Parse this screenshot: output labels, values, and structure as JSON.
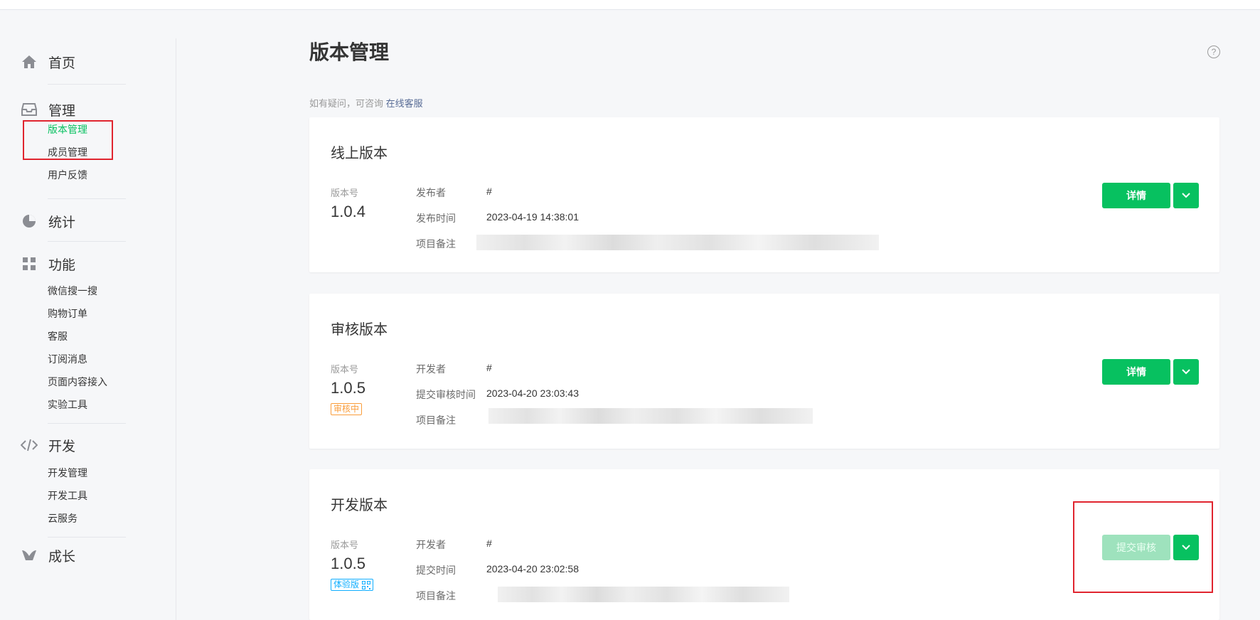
{
  "sidebar": {
    "home": "首页",
    "manage": "管理",
    "manage_items": [
      "版本管理",
      "成员管理",
      "用户反馈"
    ],
    "stats": "统计",
    "features": "功能",
    "feature_items": [
      "微信搜一搜",
      "购物订单",
      "客服",
      "订阅消息",
      "页面内容接入",
      "实验工具"
    ],
    "develop": "开发",
    "develop_items": [
      "开发管理",
      "开发工具",
      "云服务"
    ],
    "growth": "成长",
    "active_item": "版本管理"
  },
  "main": {
    "title": "版本管理",
    "help_icon": "?",
    "hint_text": "如有疑问，可咨询",
    "hint_link": "在线客服",
    "cards": [
      {
        "title": "线上版本",
        "version_label": "版本号",
        "version": "1.0.4",
        "badge": "",
        "rows": [
          {
            "label": "发布者",
            "value": "#"
          },
          {
            "label": "发布时间",
            "value": "2023-04-19 14:38:01"
          },
          {
            "label": "项目备注",
            "value": ""
          }
        ],
        "button": "详情"
      },
      {
        "title": "审核版本",
        "version_label": "版本号",
        "version": "1.0.5",
        "badge": "审核中",
        "rows": [
          {
            "label": "开发者",
            "value": "#"
          },
          {
            "label": "提交审核时间",
            "value": "2023-04-20 23:03:43"
          },
          {
            "label": "项目备注",
            "value": ""
          }
        ],
        "button": "详情"
      },
      {
        "title": "开发版本",
        "version_label": "版本号",
        "version": "1.0.5",
        "badge": "体验版",
        "rows": [
          {
            "label": "开发者",
            "value": "#"
          },
          {
            "label": "提交时间",
            "value": "2023-04-20 23:02:58"
          },
          {
            "label": "项目备注",
            "value": ""
          }
        ],
        "button": "提交审核"
      }
    ]
  },
  "colors": {
    "accent": "#07c160",
    "accent_disabled": "#9ee2bd",
    "highlight": "#e0252f",
    "badge_review": "#fa9d3b",
    "badge_trial": "#10aeff",
    "link": "#576b95"
  },
  "icons": [
    "home-icon",
    "inbox-icon",
    "pie-chart-icon",
    "grid-icon",
    "code-icon",
    "growth-icon",
    "help-icon",
    "chevron-down-icon",
    "qrcode-icon"
  ]
}
